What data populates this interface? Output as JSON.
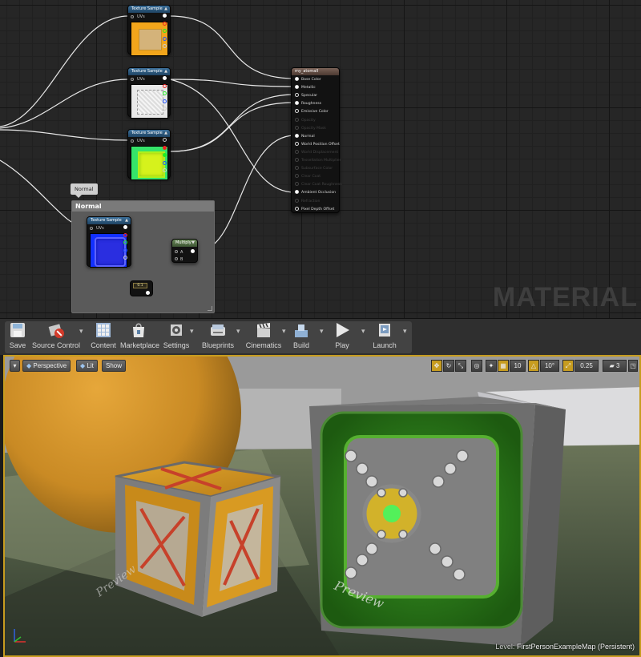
{
  "material_graph": {
    "watermark": "MATERIAL",
    "texture_nodes": [
      {
        "title": "Texture Sample",
        "input": "UVs"
      },
      {
        "title": "Texture Sample",
        "input": "UVs"
      },
      {
        "title": "Texture Sample",
        "input": "UVs"
      },
      {
        "title": "Texture Sample",
        "input": "UVs"
      }
    ],
    "result_node": {
      "title": "my_atomall",
      "pins": [
        {
          "label": "Base Color",
          "connected": true
        },
        {
          "label": "Metallic",
          "connected": true
        },
        {
          "label": "Specular",
          "connected": false
        },
        {
          "label": "Roughness",
          "connected": true
        },
        {
          "label": "Emissive Color",
          "connected": false
        },
        {
          "label": "Opacity",
          "connected": false,
          "disabled": true
        },
        {
          "label": "Opacity Mask",
          "connected": false,
          "disabled": true
        },
        {
          "label": "Normal",
          "connected": true
        },
        {
          "label": "World Position Offset",
          "connected": false
        },
        {
          "label": "World Displacement",
          "connected": false,
          "disabled": true
        },
        {
          "label": "Tessellation Multiplier",
          "connected": false,
          "disabled": true
        },
        {
          "label": "Subsurface Color",
          "connected": false,
          "disabled": true
        },
        {
          "label": "Clear Coat",
          "connected": false,
          "disabled": true
        },
        {
          "label": "Clear Coat Roughness",
          "connected": false,
          "disabled": true
        },
        {
          "label": "Ambient Occlusion",
          "connected": true
        },
        {
          "label": "Refraction",
          "connected": false,
          "disabled": true
        },
        {
          "label": "Pixel Depth Offset",
          "connected": false
        }
      ]
    },
    "comment": {
      "bubble": "Normal",
      "title": "Normal"
    },
    "multiply_node": {
      "title": "Multiply",
      "pin_a": "A",
      "pin_b": "B"
    },
    "constant_node": {
      "value": "0.1"
    }
  },
  "toolbar": {
    "buttons": [
      {
        "label": "Save",
        "icon": "save-icon"
      },
      {
        "label": "Source Control",
        "icon": "source-control-icon"
      },
      {
        "label": "Content",
        "icon": "content-browser-icon"
      },
      {
        "label": "Marketplace",
        "icon": "marketplace-icon"
      },
      {
        "label": "Settings",
        "icon": "settings-icon"
      },
      {
        "label": "Blueprints",
        "icon": "blueprints-icon"
      },
      {
        "label": "Cinematics",
        "icon": "clapperboard-icon"
      },
      {
        "label": "Build",
        "icon": "build-icon"
      },
      {
        "label": "Play",
        "icon": "play-icon"
      },
      {
        "label": "Launch",
        "icon": "launch-icon"
      }
    ]
  },
  "viewport": {
    "view_mode": "Perspective",
    "lighting": "Lit",
    "show": "Show",
    "grid_snap": "10",
    "rotation_snap": "10°",
    "scale_snap": "0.25",
    "camera_speed": "3",
    "level_label": "Level:",
    "level_name": "FirstPersonExampleMap (Persistent)",
    "floor_text_1": "Preview",
    "floor_text_2": "Preview"
  },
  "colors": {
    "accent_selected": "#c79c1f",
    "node_header_texture": "#2f5f86",
    "result_header": "#6a5248"
  }
}
